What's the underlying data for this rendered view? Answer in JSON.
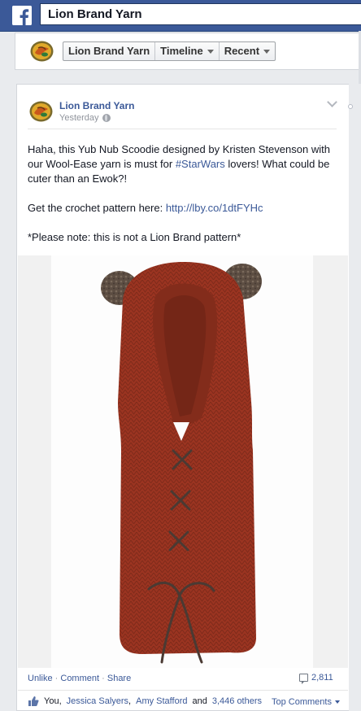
{
  "topbar": {
    "logo_letter": "f",
    "search_value": "Lion Brand Yarn"
  },
  "page_nav": {
    "items": [
      {
        "label": "Lion Brand Yarn"
      },
      {
        "label": "Timeline"
      },
      {
        "label": "Recent"
      }
    ]
  },
  "post": {
    "author": "Lion Brand Yarn",
    "time": "Yesterday",
    "text_1_pre": "Haha, this Yub Nub Scoodie designed by Kristen Stevenson with our Wool-Ease yarn is must for ",
    "hashtag": "#StarWars",
    "text_1_post": " lovers! What could be cuter than an Ewok?!",
    "text_2_pre": "Get the crochet pattern here: ",
    "link": "http://lby.co/1dtFYHc",
    "text_3": "*Please note: this is not a Lion Brand pattern*",
    "actions": {
      "unlike": "Unlike",
      "comment": "Comment",
      "share": "Share",
      "sep": "·"
    },
    "comment_count": "2,811",
    "likes": {
      "prefix": "You,",
      "name_1": "Jessica Salyers",
      "sep": ",",
      "name_2": "Amy Stafford",
      "and": "and",
      "others": "3,446 others"
    },
    "top_comments": "Top Comments"
  },
  "colors": {
    "facebook_blue": "#3b5998",
    "scarf": "#9a3320",
    "ears": "#5a4b40"
  }
}
